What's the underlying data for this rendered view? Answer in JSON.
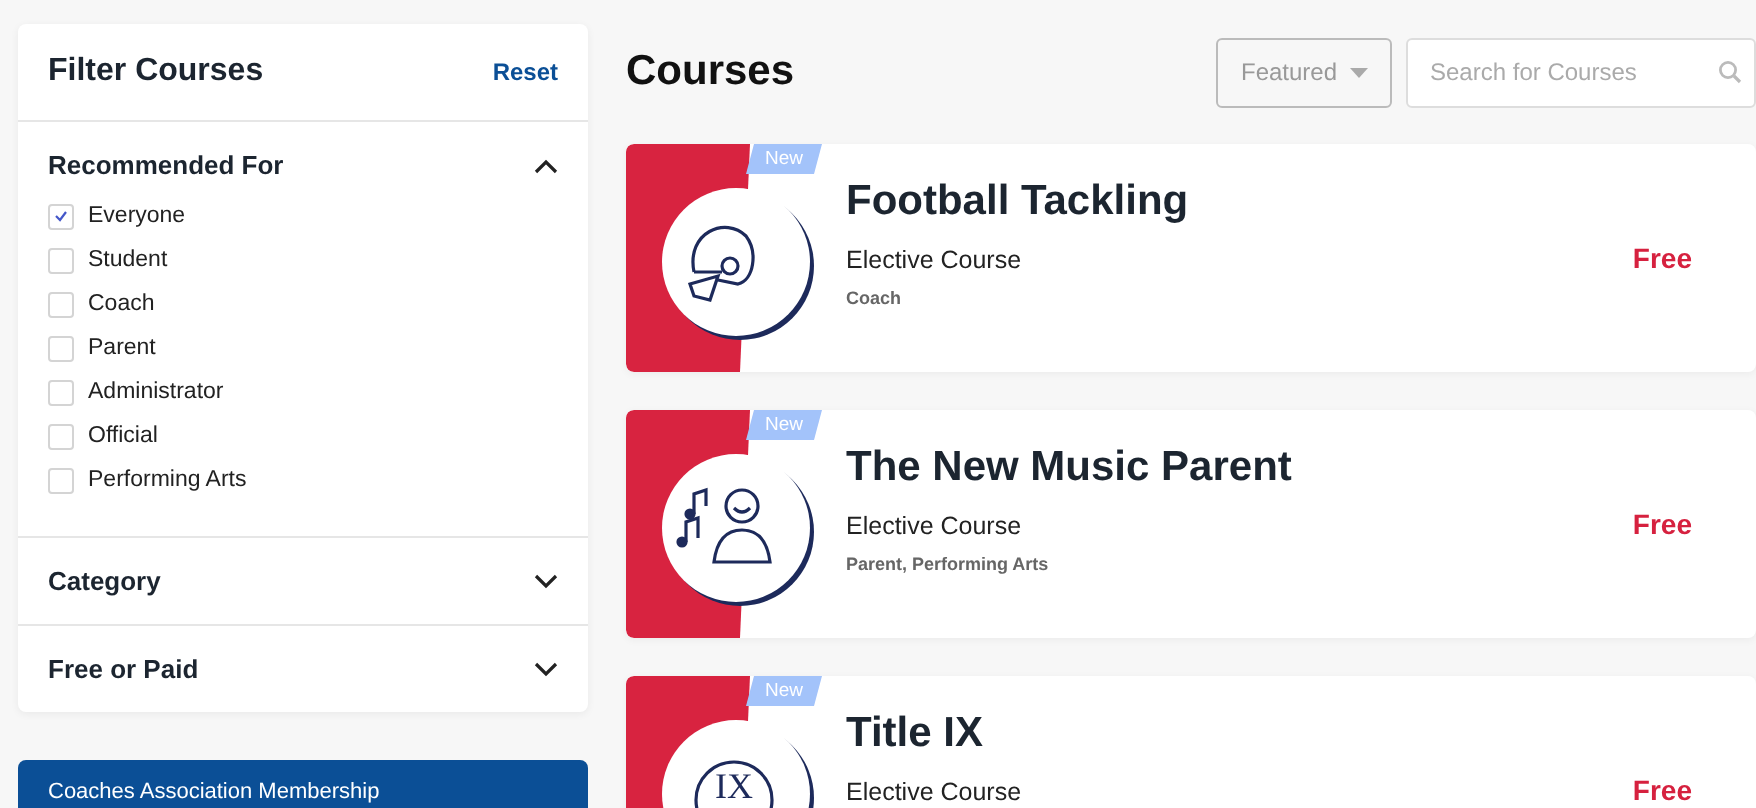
{
  "filters": {
    "title": "Filter Courses",
    "reset": "Reset",
    "sections": [
      {
        "title": "Recommended For",
        "expanded": true,
        "options": [
          {
            "label": "Everyone",
            "checked": true
          },
          {
            "label": "Student",
            "checked": false
          },
          {
            "label": "Coach",
            "checked": false
          },
          {
            "label": "Parent",
            "checked": false
          },
          {
            "label": "Administrator",
            "checked": false
          },
          {
            "label": "Official",
            "checked": false
          },
          {
            "label": "Performing Arts",
            "checked": false
          }
        ]
      },
      {
        "title": "Category",
        "expanded": false
      },
      {
        "title": "Free or Paid",
        "expanded": false
      }
    ]
  },
  "promo": {
    "title": "Coaches Association Membership"
  },
  "page_title": "Courses",
  "sort": {
    "value": "Featured"
  },
  "search": {
    "placeholder": "Search for Courses"
  },
  "courses": [
    {
      "badge": "New",
      "kind": "helmet",
      "title": "Football Tackling",
      "type": "Elective Course",
      "tags": "Coach",
      "price": "Free"
    },
    {
      "badge": "New",
      "kind": "music",
      "title": "The New Music Parent",
      "type": "Elective Course",
      "tags": "Parent, Performing Arts",
      "price": "Free"
    },
    {
      "badge": "New",
      "kind": "monogram",
      "icon_label": "IX",
      "title": "Title IX",
      "type": "Elective Course",
      "price": "Free"
    }
  ]
}
